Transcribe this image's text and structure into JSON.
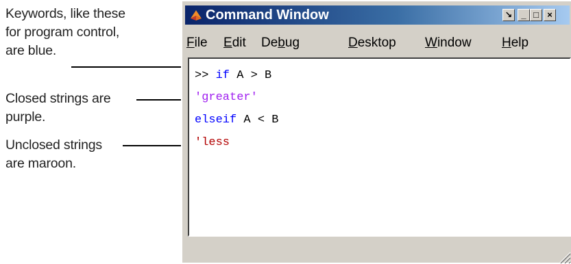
{
  "annotations": {
    "keywords": [
      "Keywords, like these",
      "for program control,",
      "are blue."
    ],
    "closed_strings": [
      "Closed strings are",
      "purple."
    ],
    "unclosed_strings": [
      "Unclosed strings",
      "are maroon."
    ]
  },
  "window": {
    "title": "Command Window",
    "title_buttons": {
      "dock": "↘",
      "minimize": "_",
      "maximize": "□",
      "close": "×"
    }
  },
  "menu": [
    {
      "accel": "F",
      "rest": "ile"
    },
    {
      "accel": "E",
      "rest": "dit"
    },
    {
      "pre": "De",
      "accel": "b",
      "rest": "ug"
    },
    {
      "accel": "D",
      "rest": "esktop"
    },
    {
      "accel": "W",
      "rest": "indow"
    },
    {
      "accel": "H",
      "rest": "elp"
    }
  ],
  "code": {
    "line1": {
      "prompt": ">> ",
      "keyword": "if",
      "rest": " A > B"
    },
    "line2": {
      "string": "'greater'"
    },
    "line3": {
      "keyword": "elseif",
      "rest": " A < B"
    },
    "line4": {
      "string": "'less"
    }
  },
  "colors": {
    "keyword": "#0000ff",
    "closed_string": "#a020f0",
    "unclosed_string": "#b20000",
    "titlebar_start": "#0a246a",
    "window_face": "#d4d0c8"
  },
  "icons": [
    "app-logo-icon",
    "dock-icon",
    "minimize-icon",
    "maximize-icon",
    "close-icon",
    "resize-grip-icon"
  ]
}
